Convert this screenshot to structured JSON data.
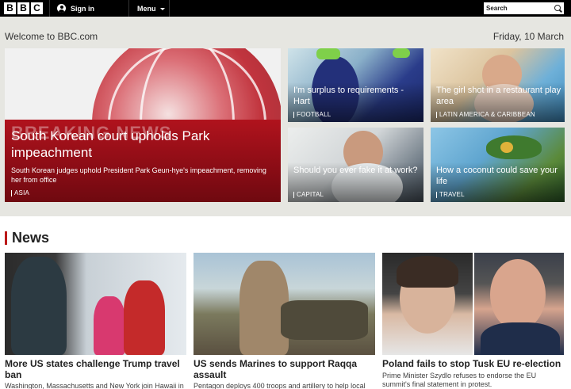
{
  "header": {
    "logo_letters": [
      "B",
      "B",
      "C"
    ],
    "signin_label": "Sign in",
    "menu_label": "Menu",
    "search_placeholder": "Search"
  },
  "welcome": "Welcome to BBC.com",
  "date": "Friday, 10 March",
  "hero": {
    "main": {
      "image_text": "BREAKING NEWS",
      "title": "South Korean court upholds Park impeachment",
      "summary": "South Korean judges uphold President Park Geun-hye's impeachment, removing her from office",
      "tag": "Asia"
    },
    "cards": [
      {
        "title": "I'm surplus to requirements - Hart",
        "tag": "Football"
      },
      {
        "title": "The girl shot in a restaurant play area",
        "tag": "Latin America & Caribbean"
      },
      {
        "title": "Should you ever fake it at work?",
        "tag": "Capital"
      },
      {
        "title": "How a coconut could save your life",
        "tag": "Travel"
      }
    ]
  },
  "news": {
    "section_title": "News",
    "items": [
      {
        "headline": "More US states challenge Trump travel ban",
        "summary": "Washington, Massachusetts and New York join Hawaii in"
      },
      {
        "headline": "US sends Marines to support Raqqa assault",
        "summary": "Pentagon deploys 400 troops and artillery to help local"
      },
      {
        "headline": "Poland fails to stop Tusk EU re-election",
        "summary": "Prime Minister Szydlo refuses to endorse the EU summit's final statement in protest."
      }
    ]
  }
}
